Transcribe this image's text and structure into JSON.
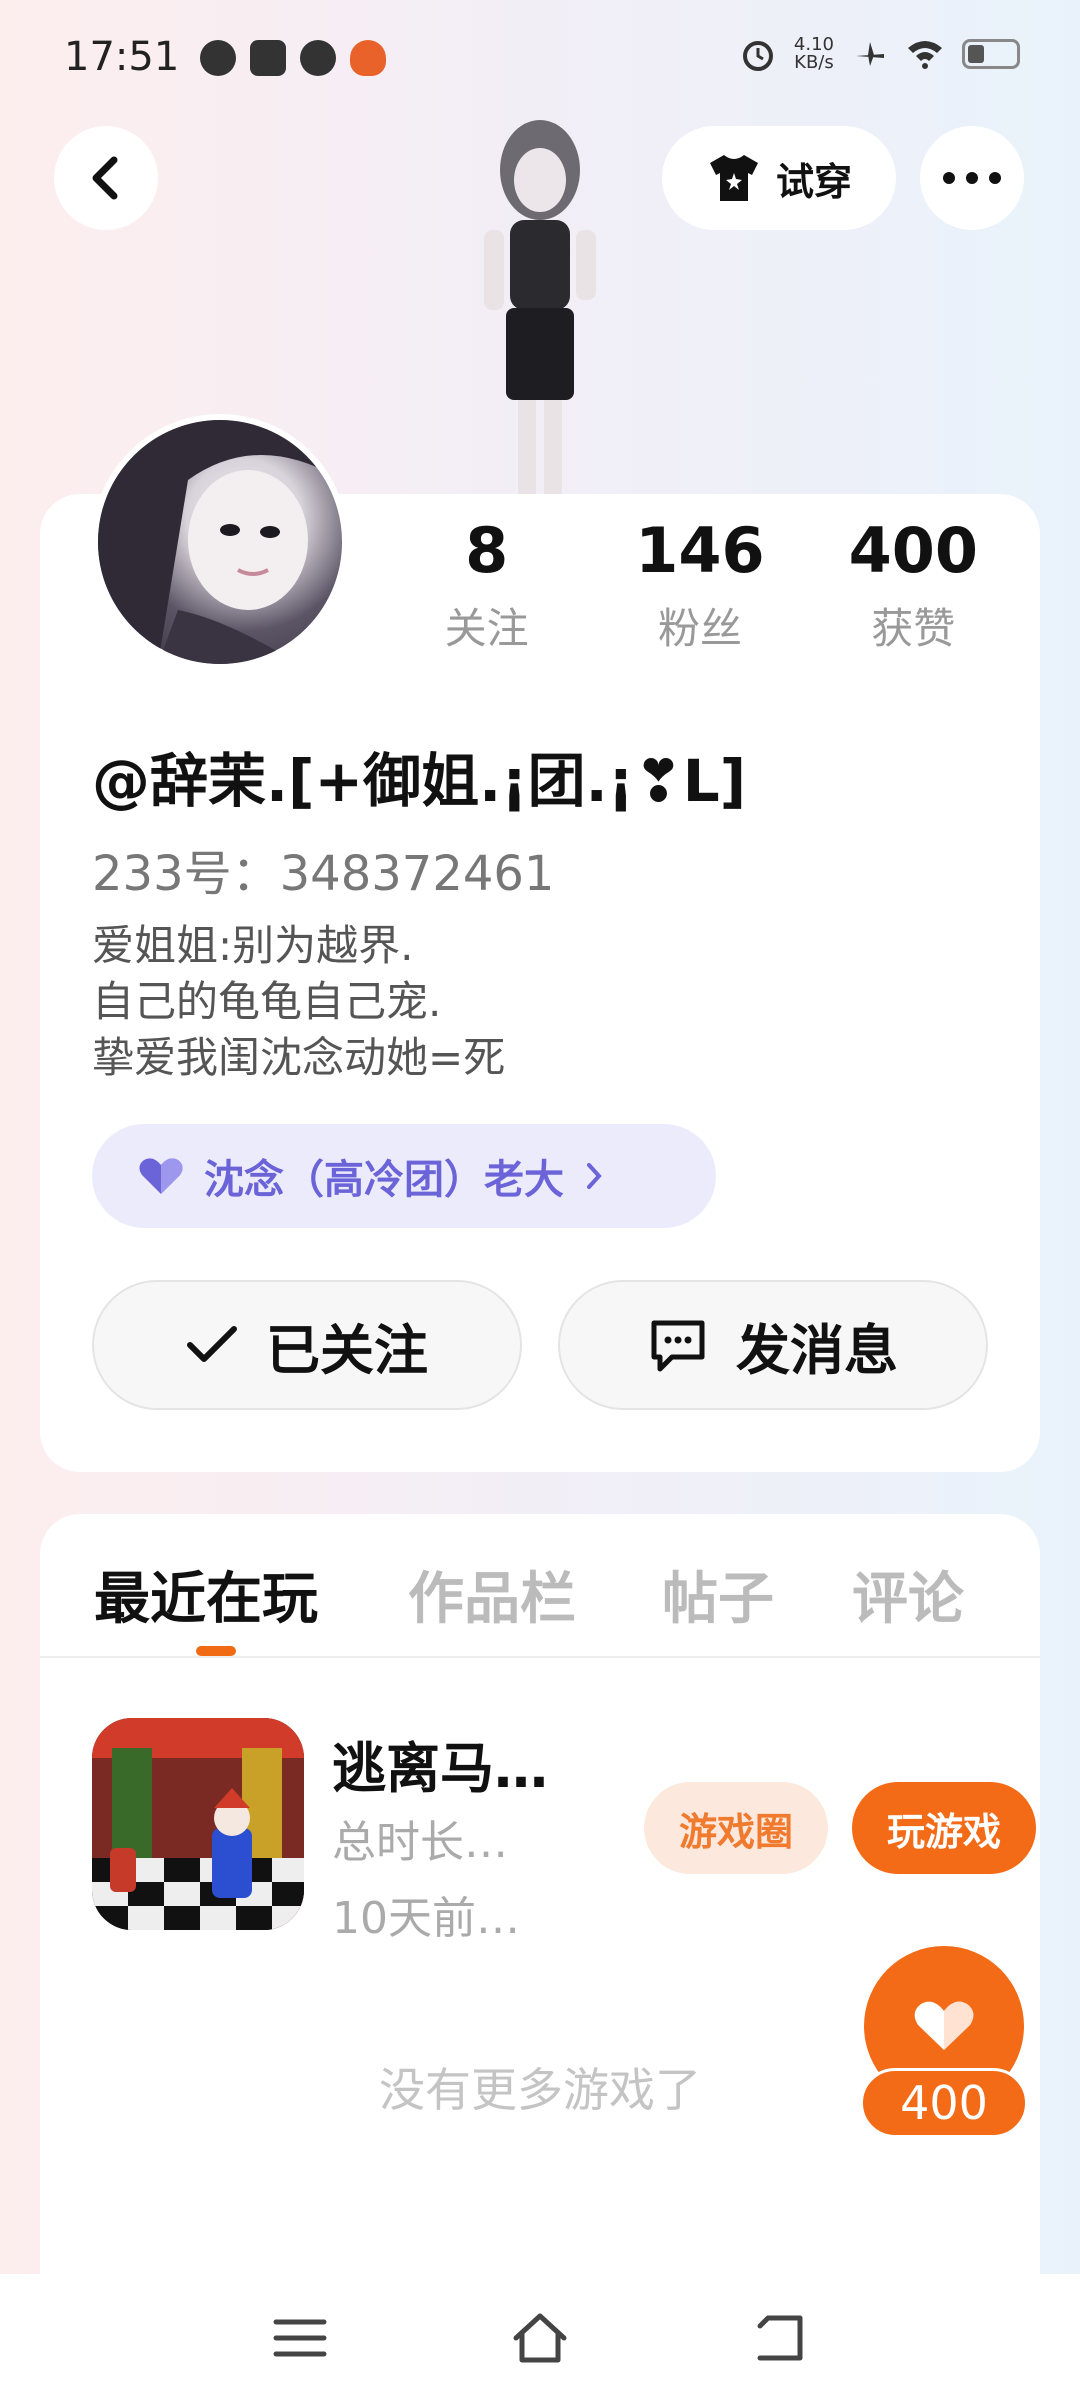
{
  "status_bar": {
    "time": "17:51",
    "speed_value": "4.10",
    "speed_unit": "KB/s",
    "icons": [
      "globe-icon",
      "mail-icon",
      "app-icon",
      "pumpkin-icon",
      "alarm-icon",
      "airplane-icon",
      "wifi-icon",
      "battery-icon"
    ]
  },
  "header": {
    "try_on_label": "试穿"
  },
  "profile": {
    "stats": [
      {
        "value": "8",
        "label": "关注"
      },
      {
        "value": "146",
        "label": "粉丝"
      },
      {
        "value": "400",
        "label": "获赞"
      }
    ],
    "username": "@辞茉.[+御姐.¡团.¡❣L]",
    "uid": "233号：348372461",
    "bio": [
      "爱姐姐:别为越界.",
      "自己的龟龟自己宠.",
      "挚爱我闺沈念动她=死"
    ],
    "group_label": "沈念（高冷团）老大",
    "follow_label": "已关注",
    "message_label": "发消息"
  },
  "tabs": [
    {
      "label": "最近在玩",
      "active": true
    },
    {
      "label": "作品栏",
      "active": false
    },
    {
      "label": "帖子",
      "active": false
    },
    {
      "label": "评论",
      "active": false
    }
  ],
  "game": {
    "title": "逃离马…",
    "duration": "总时长…",
    "last_played": "10天前…",
    "circle_label": "游戏圈",
    "play_label": "玩游戏"
  },
  "empty_text": "没有更多游戏了",
  "like": {
    "count": "400"
  },
  "colors": {
    "accent": "#f36b16",
    "group_purple": "#6b63d8",
    "group_bg": "#ecebfb"
  }
}
